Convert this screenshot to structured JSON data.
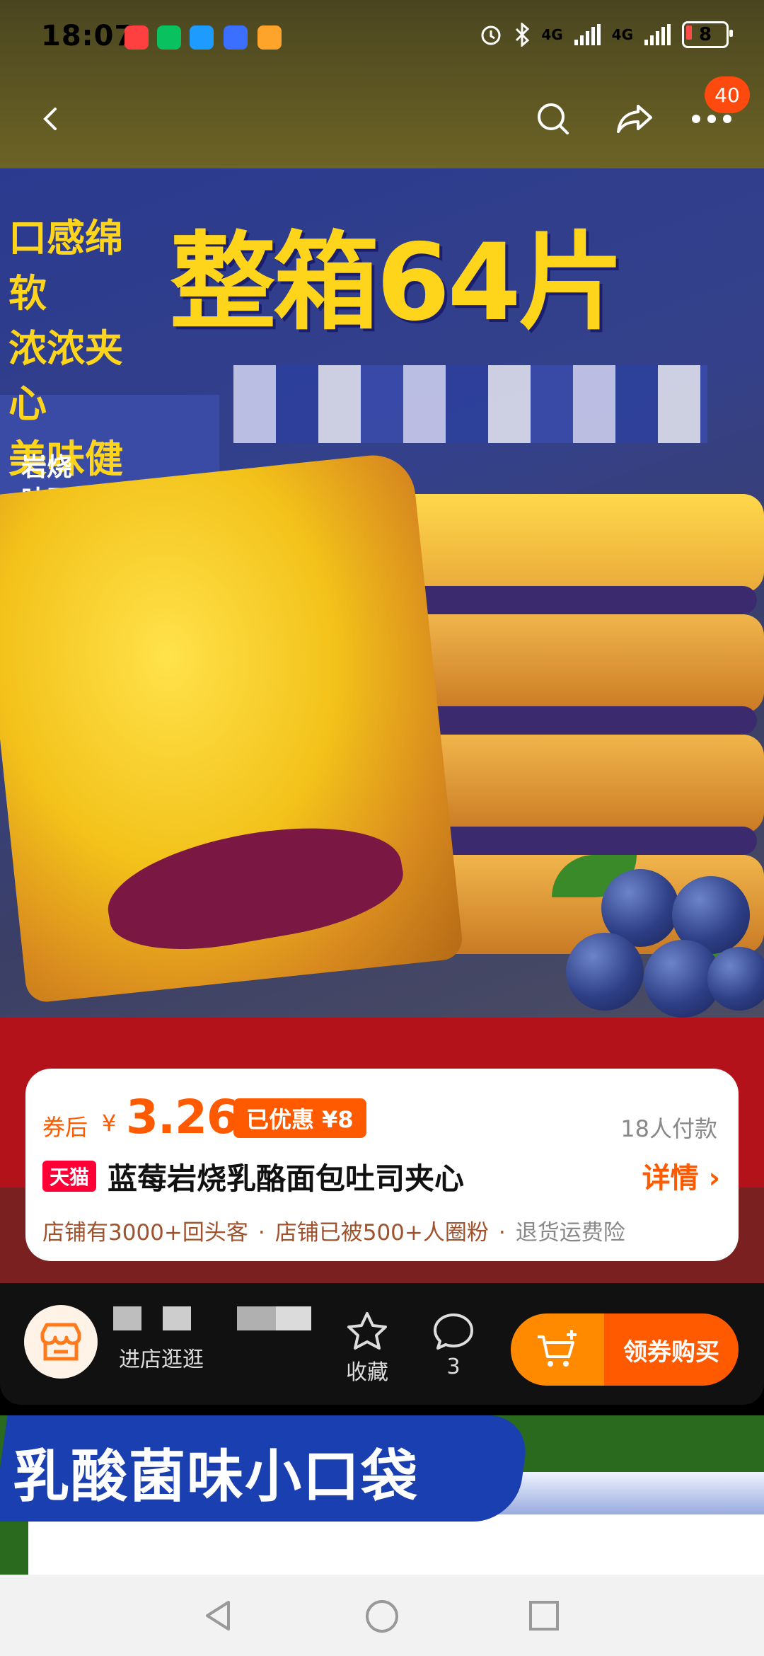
{
  "status": {
    "time": "18:07",
    "network_1": "4G",
    "network_2": "4G",
    "battery": "8"
  },
  "nav": {
    "cart_badge": "40"
  },
  "hero": {
    "headline": "整箱64片",
    "tags": [
      "口感绵软",
      "浓浓夹心",
      "美味健康"
    ],
    "box_text": "岩烧\n吐司"
  },
  "price": {
    "label": "券后",
    "currency": "¥",
    "value": "3.26",
    "discount": "已优惠 ¥8",
    "paid_count": "18人付款"
  },
  "product": {
    "platform": "天猫",
    "title": "蓝莓岩烧乳酪面包吐司夹心",
    "details": "详情 ›"
  },
  "store_info": {
    "returning": "店铺有3000+回头客",
    "fans": "店铺已被500+人圈粉",
    "insurance": "退货运费险"
  },
  "actions": {
    "enter_store": "进店逛逛",
    "favorite": "收藏",
    "comments": "3",
    "buy": "领券购买"
  },
  "next_product": {
    "title": "乳酸菌味小口袋"
  },
  "colors": {
    "accent": "#ff5a00",
    "tmall": "#ff0036",
    "price": "#ff5a00"
  }
}
